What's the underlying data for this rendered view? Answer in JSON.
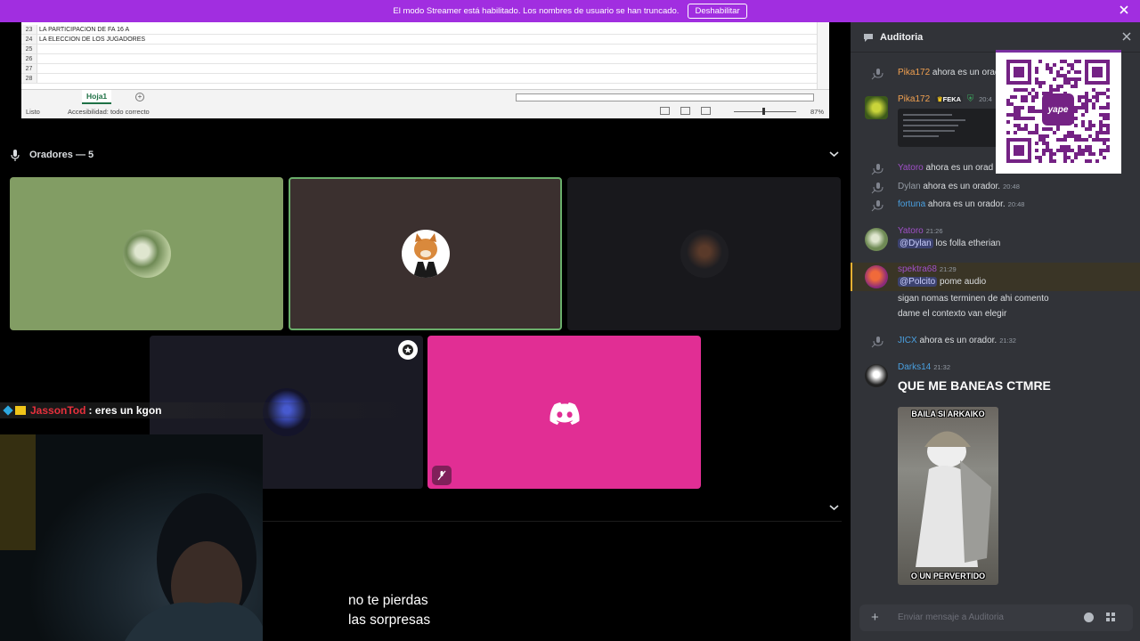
{
  "banner": {
    "text": "El modo Streamer está habilitado. Los nombres de usuario se han truncado.",
    "button": "Deshabilitar"
  },
  "spreadsheet": {
    "rows": [
      {
        "num": "23",
        "text": "LA PARTICIPACION DE FA 16 A"
      },
      {
        "num": "24",
        "text": "LA ELECCION DE LOS JUGADORES"
      },
      {
        "num": "25",
        "text": ""
      },
      {
        "num": "26",
        "text": ""
      },
      {
        "num": "27",
        "text": ""
      },
      {
        "num": "28",
        "text": ""
      }
    ],
    "sheet_tab": "Hoja1",
    "status_ready": "Listo",
    "status_accessibility": "Accesibilidad: todo correcto",
    "zoom": "87%"
  },
  "stage": {
    "speakers_header": "Oradores — 5"
  },
  "overlay_chat": {
    "user": "JassonTod",
    "message": ": eres un kgon"
  },
  "caption": {
    "line1": "no te pierdas",
    "line2": "las sorpresas"
  },
  "panel": {
    "title": "Auditoria",
    "messages": [
      {
        "type": "system",
        "name": "Pika172",
        "text": "ahora es un orad",
        "name_color": "#f0a050"
      },
      {
        "type": "message",
        "name": "Pika172",
        "badge": "FEKA",
        "time": "20:4",
        "name_color": "#f0a050"
      },
      {
        "type": "system",
        "name": "Yatoro",
        "text": "ahora es un orad",
        "name_color": "#a050c8"
      },
      {
        "type": "system",
        "name": "Dylan",
        "text": "ahora es un orador.",
        "time": "20:48",
        "name_color": "#949ba4"
      },
      {
        "type": "system",
        "name": "fortuna",
        "text": "ahora es un orador.",
        "time": "20:48",
        "name_color": "#4aa0e0"
      },
      {
        "type": "message",
        "name": "Yatoro",
        "time": "21:26",
        "mention": "@Dylan",
        "text": "los folla etherian",
        "name_color": "#a050c8"
      },
      {
        "type": "message",
        "name": "spektra68",
        "time": "21:29",
        "mention": "@Polcito",
        "text": "pome audio",
        "line2": "sigan nomas terminen de ahi comento",
        "line3": "dame el contexto van elegir",
        "name_color": "#a050c8"
      },
      {
        "type": "system",
        "name": "JICX",
        "text": "ahora es un orador.",
        "time": "21:32",
        "name_color": "#4aa0e0"
      },
      {
        "type": "message",
        "name": "Darks14",
        "time": "21:32",
        "text": "QUE ME BANEAS CTMRE",
        "image_top": "BAILA SI ARKAIKO",
        "image_bottom": "O UN PERVERTIDO",
        "name_color": "#4aa0e0"
      }
    ],
    "composer_placeholder": "Enviar mensaje a Auditoria"
  },
  "qr": {
    "brand": "yape"
  },
  "icons": {
    "banner_close": "close-icon",
    "speaker_mic": "microphone-icon",
    "chevron": "chevron-down-icon",
    "stage_channel": "stage-channel-icon",
    "pin": "pin-icon",
    "muted": "muted-icon",
    "discord_logo": "discord-logo-icon",
    "add": "plus-icon",
    "emoji": "emoji-icon",
    "apps": "apps-icon"
  },
  "colors": {
    "banner": "#a12ee0",
    "panel_bg": "#313338",
    "speaking_border": "#6aae6a",
    "discord_tile": "#e12e94",
    "mention_bg": "#3c4270",
    "highlight_bar": "#f0b132"
  }
}
